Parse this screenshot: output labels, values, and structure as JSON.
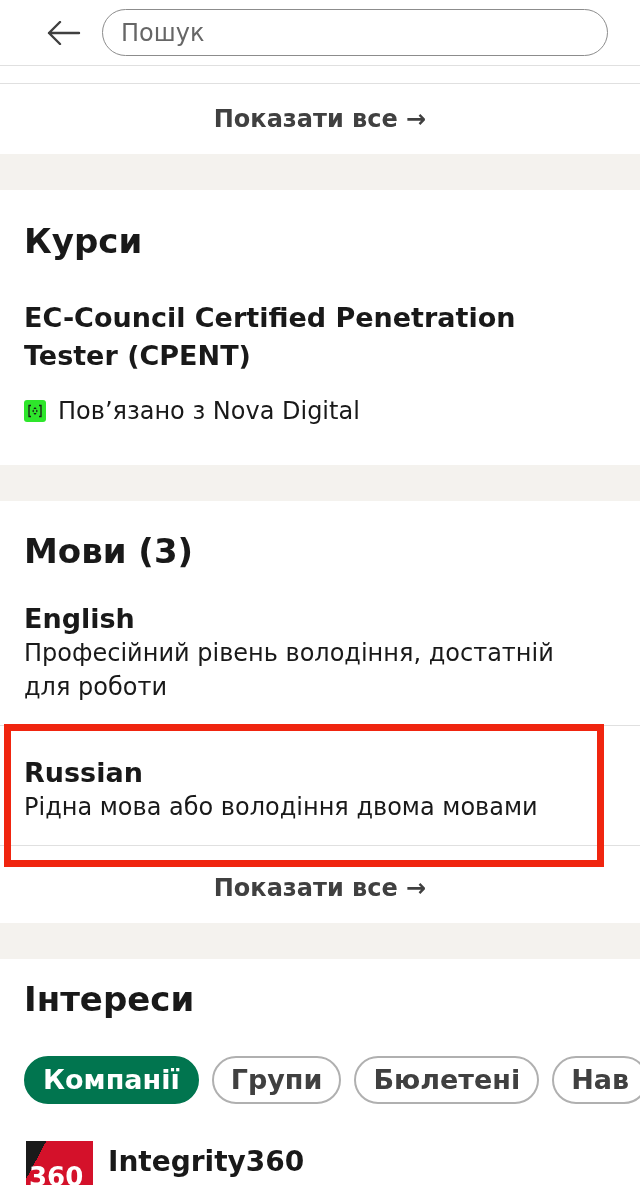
{
  "header": {
    "search": {
      "placeholder": "Пошук"
    }
  },
  "previous_section": {
    "show_all": "Показати все →"
  },
  "courses": {
    "title": "Курси",
    "items": [
      {
        "name": "EC-Council Certified Penetration Tester (CPENT)",
        "association": "Пов’язано з Nova Digital"
      }
    ]
  },
  "languages": {
    "title": "Мови (3)",
    "items": [
      {
        "name": "English",
        "proficiency": "Професійний рівень володіння, достатній для роботи",
        "highlighted": false
      },
      {
        "name": "Russian",
        "proficiency": "Рідна мова або володіння двома мовами",
        "highlighted": true
      }
    ],
    "show_all": "Показати все →"
  },
  "interests": {
    "title": "Інтереси",
    "tabs": [
      {
        "label": "Компанії",
        "selected": true
      },
      {
        "label": "Групи",
        "selected": false
      },
      {
        "label": "Бюлетені",
        "selected": false
      },
      {
        "label": "Нав",
        "selected": false
      }
    ],
    "items": [
      {
        "name": "Integrity360",
        "logo_text": "360"
      }
    ]
  }
}
